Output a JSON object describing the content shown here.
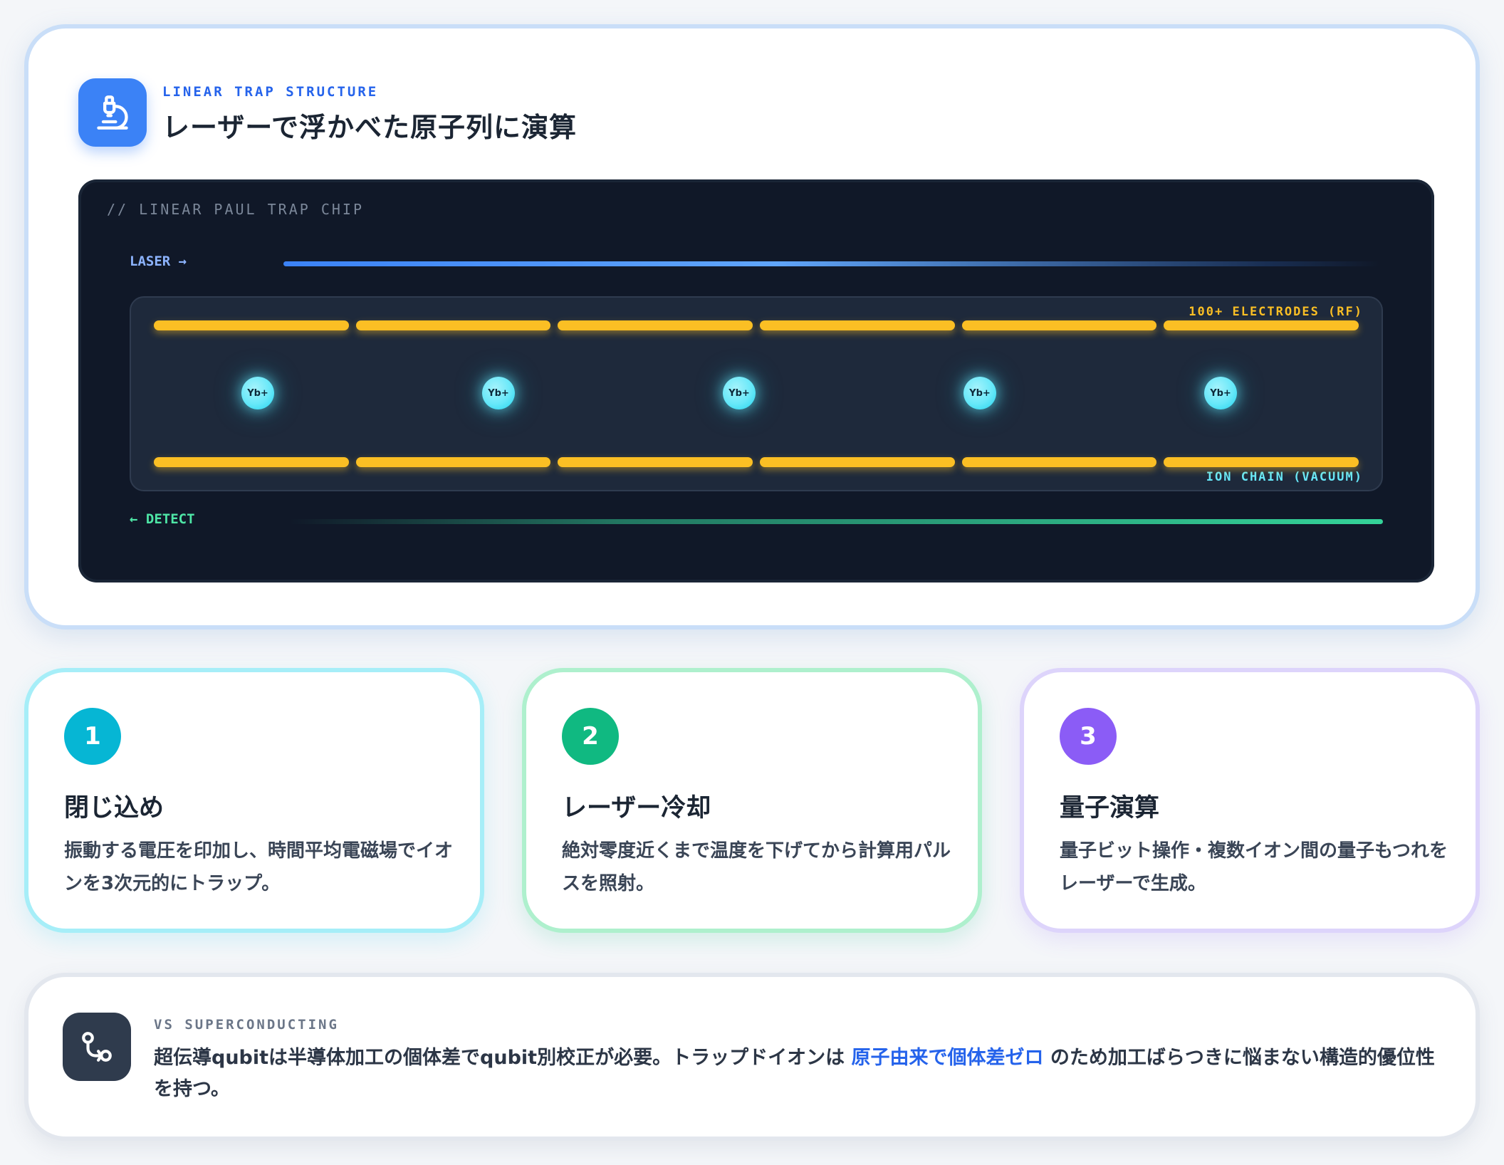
{
  "hero": {
    "eyebrow": "LINEAR TRAP STRUCTURE",
    "title": "レーザーで浮かべた原子列に演算",
    "icon": "microscope-icon",
    "chip": {
      "label": "// LINEAR PAUL TRAP CHIP",
      "laser_label": "LASER →",
      "detect_label": "← DETECT",
      "electrodes_label": "100+ ELECTRODES (RF)",
      "ion_chain_label": "ION CHAIN (VACUUM)",
      "ions": [
        "Yb+",
        "Yb+",
        "Yb+",
        "Yb+",
        "Yb+"
      ],
      "electrodes_per_row": 6,
      "colors": {
        "background": "#101828",
        "electrode": "#fbbf24",
        "ion": "#67e8f9",
        "laser": "#3b82f6",
        "detect": "#34d399"
      }
    }
  },
  "steps": [
    {
      "number": "1",
      "title": "閉じ込め",
      "text": "振動する電圧を印加し、時間平均電磁場でイオンを3次元的にトラップ。",
      "color": "#06b6d4"
    },
    {
      "number": "2",
      "title": "レーザー冷却",
      "text": "絶対零度近くまで温度を下げてから計算用パルスを照射。",
      "color": "#10b981"
    },
    {
      "number": "3",
      "title": "量子演算",
      "text": "量子ビット操作・複数イオン間の量子もつれをレーザーで生成。",
      "color": "#8b5cf6"
    }
  ],
  "comparison": {
    "eyebrow": "VS SUPERCONDUCTING",
    "icon": "git-compare-icon",
    "text_before": "超伝導qubitは半導体加工の個体差でqubit別校正が必要。トラップドイオンは ",
    "highlight": "原子由来で個体差ゼロ",
    "text_after": " のため加工ばらつきに悩まない構造的優位性を持つ。",
    "highlight_color": "#2563eb"
  }
}
